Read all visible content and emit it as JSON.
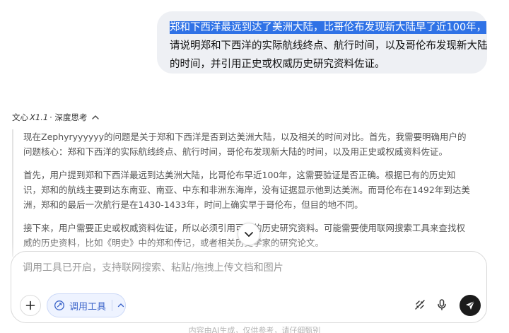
{
  "user_message": {
    "line1_selected": "郑和下西洋最远到达了美洲大陆，比哥伦布发现新大陆早了近100年，",
    "line2": "请说明郑和下西洋的实际航线终点、航行时间，以及哥伦布发现新大陆",
    "line3": "的时间，并引用正史或权威历史研究资料佐证。"
  },
  "model": {
    "prefix": "文心 ",
    "name": "X1.1",
    "suffix": " · 深度思考"
  },
  "thinking": {
    "paragraphs": [
      "现在Zephyryyyyyy的问题是关于郑和下西洋是否到达美洲大陆，以及相关的时间对比。首先，我需要明确用户的问题核心：郑和下西洋的实际航线终点、航行时间，哥伦布发现新大陆的时间，以及用正史或权威资料佐证。",
      "首先，用户提到郑和下西洋最远到达美洲大陆，比哥伦布早近100年，这需要验证是否正确。根据已有的历史知识，郑和的航线主要到达东南亚、南亚、中东和非洲东海岸，没有证据显示他到达美洲。而哥伦布在1492年到达美洲，郑和的最后一次航行是在1430-1433年，时间上确实早于哥伦布，但目的地不同。",
      "接下来，用户需要正史或权威资料佐证，所以必须引用可靠的历史研究资料。可能需要使用联网搜索工具来查找权威的历史资料，比如《明史》中的郑和传记，或者相关历史学家的研究论文。"
    ]
  },
  "composer": {
    "placeholder": "调用工具已开启，支持联网搜索、粘贴/拖拽上传文档和图片",
    "tools_label": "调用工具"
  },
  "footer": {
    "text": "内容由AI生成，仅供参考，请仔细甄别"
  },
  "icons": {
    "collapse": "chevron-up-icon",
    "scroll_down": "chevron-down-icon",
    "add": "plus-icon",
    "tools": "tool-icon",
    "tools_expand": "chevron-up-icon",
    "no_link": "link-off-icon",
    "voice": "microphone-icon",
    "send": "send-icon"
  },
  "colors": {
    "selection": "#2f72e6",
    "user_bubble": "#eef0f4",
    "tools_accent": "#3a63c9",
    "send_button": "#1b1b1b"
  }
}
